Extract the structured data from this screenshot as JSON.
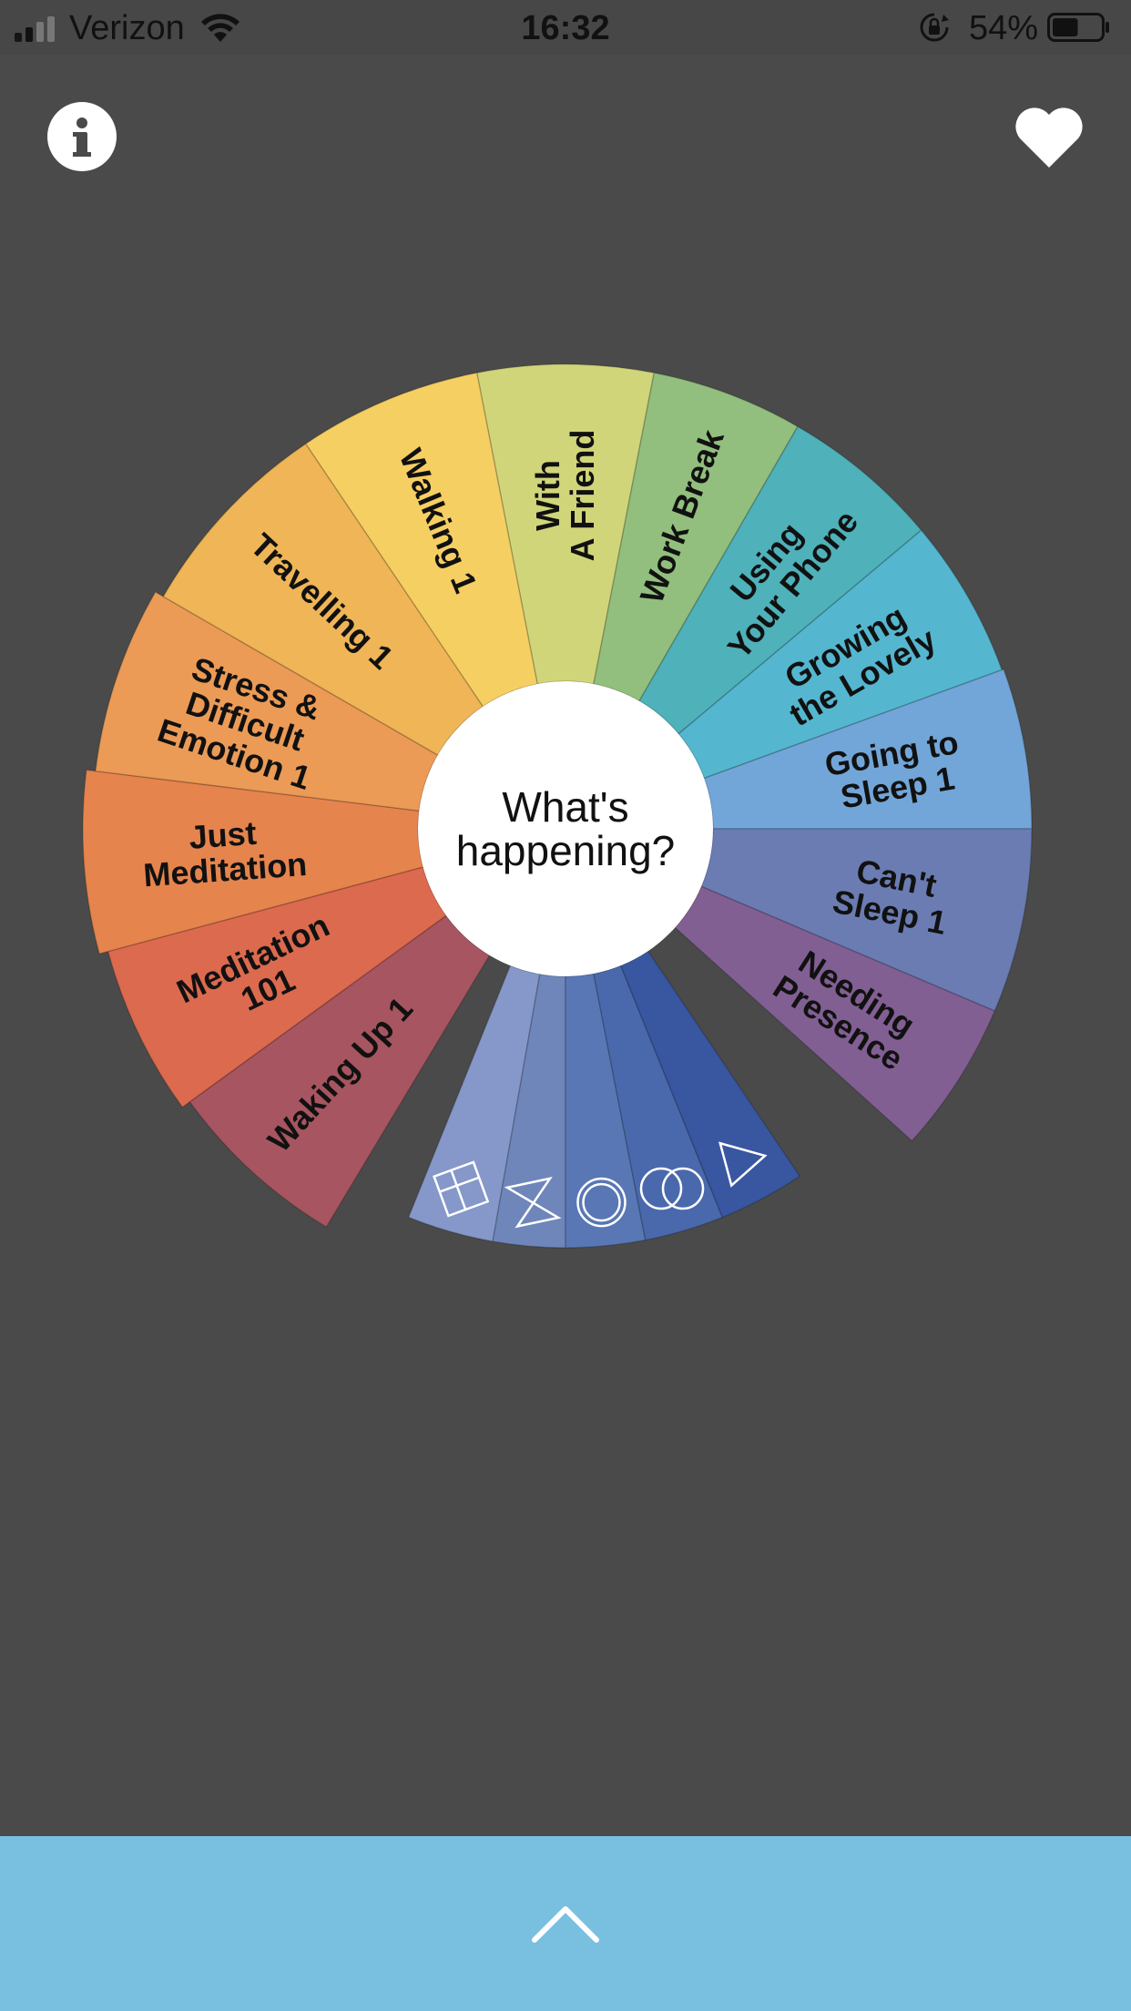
{
  "status_bar": {
    "carrier": "Verizon",
    "time": "16:32",
    "battery_percent": "54%",
    "signal_icon": "signal-bars-icon",
    "wifi_icon": "wifi-icon",
    "lock_icon": "rotation-lock-icon",
    "battery_icon": "battery-icon",
    "battery_level": 0.54
  },
  "header": {
    "info_icon": "info-icon",
    "favorites_icon": "heart-icon"
  },
  "wheel": {
    "center_label_line1": "What's",
    "center_label_line2": "happening?",
    "segments": [
      {
        "lines": [
          "With",
          "A Friend"
        ],
        "color": "#d0d57a"
      },
      {
        "lines": [
          "Work Break"
        ],
        "color": "#92bf7d"
      },
      {
        "lines": [
          "Using",
          "Your Phone"
        ],
        "color": "#4fb1b9"
      },
      {
        "lines": [
          "Growing",
          "the Lovely"
        ],
        "color": "#55b6cf"
      },
      {
        "lines": [
          "Going to",
          "Sleep 1"
        ],
        "color": "#72a6d8"
      },
      {
        "lines": [
          "Can't",
          "Sleep 1"
        ],
        "color": "#6b7cb3"
      },
      {
        "lines": [
          "Needing",
          "Presence"
        ],
        "color": "#815f93"
      },
      {
        "lines": [
          "Waking Up 1"
        ],
        "color": "#a75560"
      },
      {
        "lines": [
          "Meditation",
          "101"
        ],
        "color": "#dc6a4e"
      },
      {
        "lines": [
          "Just",
          "Meditation"
        ],
        "color": "#e6844d"
      },
      {
        "lines": [
          "Stress &",
          "Difficult",
          "Emotion 1"
        ],
        "color": "#eb9b56"
      },
      {
        "lines": [
          "Travelling 1"
        ],
        "color": "#efb556"
      },
      {
        "lines": [
          "Walking 1"
        ],
        "color": "#f6cf63"
      }
    ],
    "symbol_segments": [
      {
        "icon": "squares-symbol-icon",
        "color": "#8598c9"
      },
      {
        "icon": "bowtie-symbol-icon",
        "color": "#6f86bb"
      },
      {
        "icon": "circle-symbol-icon",
        "color": "#5877b4"
      },
      {
        "icon": "double-circle-symbol-icon",
        "color": "#4a69ac"
      },
      {
        "icon": "triangle-symbol-icon",
        "color": "#3956a0"
      }
    ]
  },
  "bottom_bar": {
    "color": "#78bfe0",
    "expand_icon": "chevron-up-icon"
  }
}
